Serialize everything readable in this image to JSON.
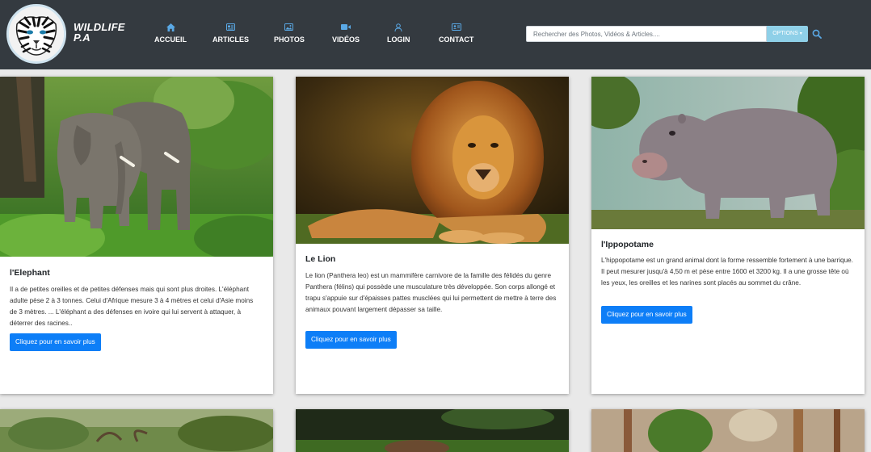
{
  "brand": {
    "line1": "WILDLIFE",
    "line2": "P.A"
  },
  "nav": [
    {
      "label": "ACCUEIL",
      "icon": "home-icon"
    },
    {
      "label": "ARTICLES",
      "icon": "article-icon"
    },
    {
      "label": "PHOTOS",
      "icon": "photo-icon"
    },
    {
      "label": "VIDÉOS",
      "icon": "video-icon"
    },
    {
      "label": "LOGIN",
      "icon": "user-icon"
    },
    {
      "label": "CONTACT",
      "icon": "contact-card-icon"
    }
  ],
  "search": {
    "placeholder": "Rechercher des Photos, Vidéos & Articles....",
    "options_label": "OPTIONS"
  },
  "cards": [
    {
      "title": "l'Elephant",
      "text": "Il a de petites oreilles et de petites défenses mais qui sont plus droites. L'éléphant adulte pèse 2 à 3 tonnes. Celui d'Afrique mesure 3 à 4 mètres et celui d'Asie moins de 3 mètres. ... L'éléphant a des défenses en ivoire qui lui servent à attaquer, à déterrer des racines..",
      "button": "Cliquez pour en savoir plus",
      "image": "elephants"
    },
    {
      "title": "Le Lion",
      "text": "Le lion (Panthera leo) est un mammifère carnivore de la famille des félidés du genre Panthera (félins) qui possède une musculature très développée. Son corps allongé et trapu s'appuie sur d'épaisses pattes musclées qui lui permettent de mettre à terre des animaux pouvant largement dépasser sa taille.",
      "button": "Cliquez pour en savoir plus",
      "image": "lion"
    },
    {
      "title": "l'Ippopotame",
      "text": "L'hippopotame est un grand animal dont la forme ressemble fortement à une barrique. Il peut mesurer jusqu'à 4,50 m et pèse entre 1600 et 3200 kg. Il a une grosse tête où les yeux, les oreilles et les narines sont placés au sommet du crâne.",
      "button": "Cliquez pour en savoir plus",
      "image": "hippo"
    }
  ],
  "colors": {
    "navbar": "#343a40",
    "primary_button": "#0d7ef7",
    "options_button": "#8fd0e8",
    "background": "#e9e9e9"
  }
}
